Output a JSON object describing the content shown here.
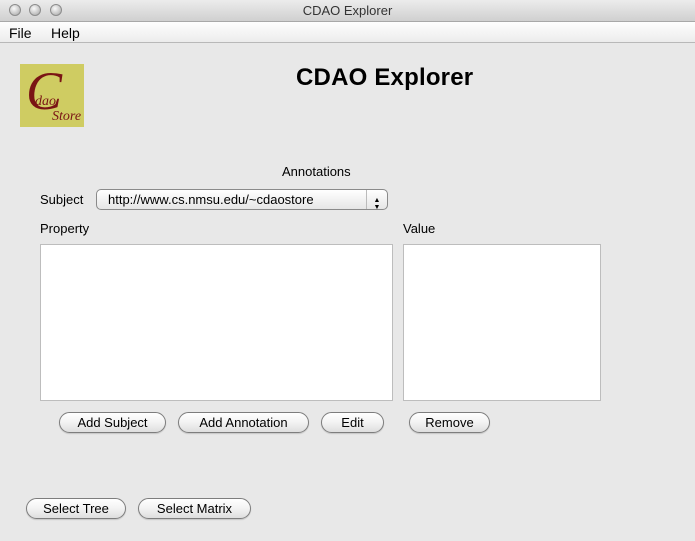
{
  "window": {
    "title": "CDAO Explorer"
  },
  "menu": {
    "items": [
      "File",
      "Help"
    ]
  },
  "logo": {
    "big_letter": "C",
    "small_top": "dao",
    "small_bottom": "Store"
  },
  "header": {
    "title": "CDAO Explorer"
  },
  "annotations": {
    "heading": "Annotations",
    "subject_label": "Subject",
    "subject_value": "http://www.cs.nmsu.edu/~cdaostore",
    "property_label": "Property",
    "value_label": "Value"
  },
  "buttons": {
    "add_subject": "Add Subject",
    "add_annotation": "Add Annotation",
    "edit": "Edit",
    "remove": "Remove",
    "select_tree": "Select Tree",
    "select_matrix": "Select Matrix"
  }
}
